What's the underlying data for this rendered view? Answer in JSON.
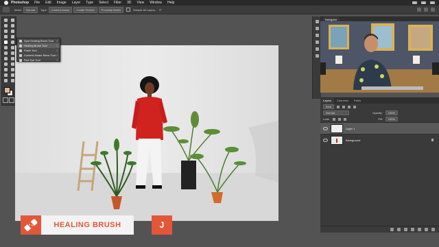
{
  "menubar": {
    "app": "Photoshop",
    "items": [
      "File",
      "Edit",
      "Image",
      "Layer",
      "Type",
      "Select",
      "Filter",
      "3D",
      "View",
      "Window",
      "Help"
    ]
  },
  "options": {
    "mode_label": "Mode:",
    "mode_value": "Normal",
    "type_label": "Type:",
    "type_value": "Content-Aware",
    "create_texture": "Create Texture",
    "proximity_match": "Proximity Match",
    "sample_all_layers": "Sample All Layers",
    "angle": "0°"
  },
  "flyout": {
    "items": [
      {
        "label": "Spot Healing Brush Tool",
        "key": "J"
      },
      {
        "label": "Healing Brush Tool",
        "key": "J"
      },
      {
        "label": "Patch Tool",
        "key": "J"
      },
      {
        "label": "Content-Aware Move Tool",
        "key": "J"
      },
      {
        "label": "Red Eye Tool",
        "key": "J"
      }
    ]
  },
  "navigator": {
    "tab": "Navigator"
  },
  "layers": {
    "tabs": [
      "Layers",
      "Channels",
      "Paths"
    ],
    "kind": "Kind",
    "blend": "Normal",
    "opacity_label": "Opacity:",
    "opacity": "100%",
    "lock_label": "Lock:",
    "fill_label": "Fill:",
    "fill": "100%",
    "items": [
      {
        "name": "Layer 1"
      },
      {
        "name": "Background"
      }
    ]
  },
  "lower_third": {
    "title": "HEALING BRUSH",
    "key": "J"
  },
  "colors": {
    "accent": "#e2573a",
    "shirt": "#d0221e"
  }
}
